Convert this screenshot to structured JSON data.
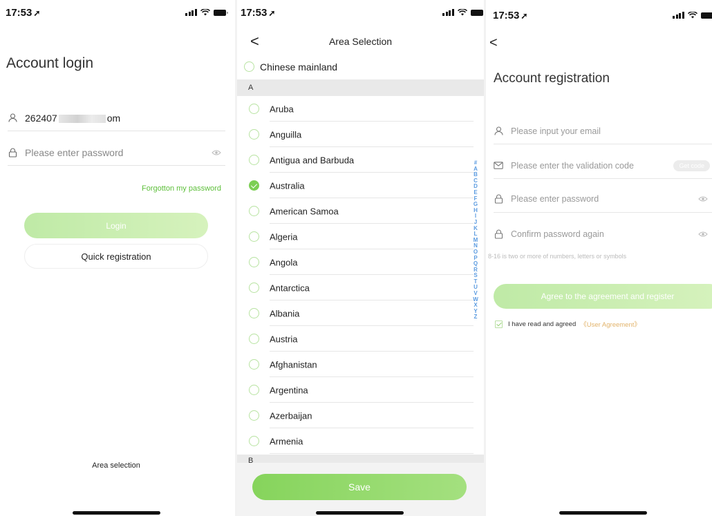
{
  "login": {
    "time": "17:53",
    "title": "Account login",
    "account_value_start": "262407",
    "account_value_end": "om",
    "password_placeholder": "Please enter password",
    "forgot_link": "Forgotton my password",
    "login_button": "Login",
    "register_button": "Quick registration",
    "area_selection": "Area selection"
  },
  "area": {
    "time": "17:53",
    "back": "<",
    "title": "Area Selection",
    "top_option": "Chinese mainland",
    "section_a": "A",
    "section_b": "B",
    "countries": [
      {
        "name": "Aruba",
        "selected": false
      },
      {
        "name": "Anguilla",
        "selected": false
      },
      {
        "name": "Antigua and Barbuda",
        "selected": false
      },
      {
        "name": "Australia",
        "selected": true
      },
      {
        "name": "American Samoa",
        "selected": false
      },
      {
        "name": "Algeria",
        "selected": false
      },
      {
        "name": "Angola",
        "selected": false
      },
      {
        "name": "Antarctica",
        "selected": false
      },
      {
        "name": "Albania",
        "selected": false
      },
      {
        "name": "Austria",
        "selected": false
      },
      {
        "name": "Afghanistan",
        "selected": false
      },
      {
        "name": "Argentina",
        "selected": false
      },
      {
        "name": "Azerbaijan",
        "selected": false
      },
      {
        "name": "Armenia",
        "selected": false
      }
    ],
    "index_letters": [
      "#",
      "A",
      "B",
      "C",
      "D",
      "E",
      "F",
      "G",
      "H",
      "I",
      "J",
      "K",
      "L",
      "M",
      "N",
      "O",
      "P",
      "Q",
      "R",
      "S",
      "T",
      "U",
      "V",
      "W",
      "X",
      "Y",
      "Z"
    ],
    "save_button": "Save"
  },
  "register": {
    "time": "17:53",
    "back": "<",
    "title": "Account registration",
    "email_placeholder": "Please input your email",
    "code_placeholder": "Please enter the validation code",
    "get_code": "Get code",
    "password_placeholder": "Please enter password",
    "confirm_placeholder": "Confirm password again",
    "password_hint": "8-16 is two or more of numbers, letters or symbols",
    "submit_button": "Agree to the agreement and register",
    "agree_text": "I have read and agreed",
    "agreement_link": "《User Agreement》"
  },
  "colors": {
    "accent_green": "#7ccf54",
    "link_green": "#5dbf3a",
    "button_green_light": "#c9efb0",
    "agreement_gold": "#e2b36a",
    "index_blue": "#5b9be0"
  },
  "icons": [
    "location-arrow-icon",
    "signal-icon",
    "wifi-icon",
    "battery-icon",
    "user-icon",
    "lock-icon",
    "eye-icon",
    "mail-icon",
    "checkbox-icon",
    "back-chevron-icon",
    "radio-icon"
  ]
}
